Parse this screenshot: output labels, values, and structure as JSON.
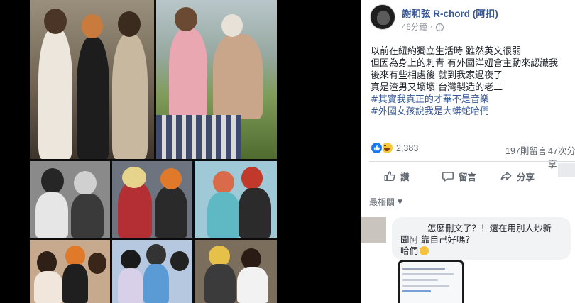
{
  "post": {
    "author": "謝和弦 R-chord (阿扣)",
    "time": "46分鐘",
    "separator": "·",
    "body_lines": [
      "以前在紐約獨立生活時 雖然英文很弱",
      "但因為身上的刺青 有外國洋妞會主動來認識我",
      "後來有些相處後 就到我家過夜了",
      "真是渣男又壞壞 台灣製造的老二"
    ],
    "hashtags": [
      "#其實我真正的才華不是音樂",
      "#外國女孩說我是大蟒蛇哈們"
    ],
    "reaction_count": "2,383",
    "comment_count": "197則留言",
    "share_count": "47次分享",
    "actions": {
      "like": "讚",
      "comment": "留言",
      "share": "分享"
    },
    "sort_label": "最相關"
  },
  "comment": {
    "lines": [
      "怎麼刪文了？！還在用別人炒新",
      "聞阿 靠自己好嗎？",
      "哈們"
    ]
  },
  "icons": {
    "globe": "globe-icon",
    "like_reaction": "like-reaction-icon",
    "haha_reaction": "haha-reaction-icon",
    "like": "thumbs-up-icon",
    "comment": "speech-bubble-icon",
    "share": "share-arrow-icon",
    "chevron": "chevron-down-icon",
    "sweat_emoji": "sweat-smile-emoji"
  },
  "colors": {
    "link": "#385898",
    "hashtag": "#365899",
    "meta": "#90949c",
    "like_blue": "#1877f2",
    "text": "#1d2129"
  }
}
